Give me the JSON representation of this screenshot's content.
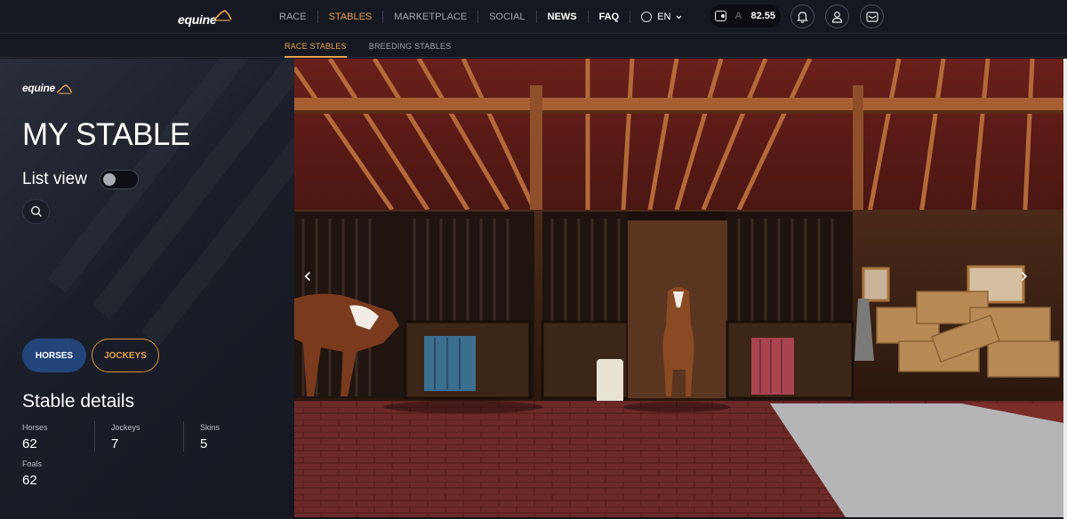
{
  "brand": {
    "logo_text": "equine",
    "accent": "#e6a04d"
  },
  "nav": {
    "items": [
      {
        "label": "RACE"
      },
      {
        "label": "STABLES"
      },
      {
        "label": "MARKETPLACE"
      },
      {
        "label": "SOCIAL"
      },
      {
        "label": "NEWS"
      },
      {
        "label": "FAQ"
      }
    ],
    "language": "EN",
    "language_icon": "globe-icon",
    "wallet_balance": "82.55",
    "wallet_coin": "A",
    "icons": [
      "wallet-icon",
      "bell-icon",
      "user-icon",
      "mail-icon"
    ]
  },
  "subnav": {
    "items": [
      {
        "label": "RACE STABLES"
      },
      {
        "label": "BREEDING STABLES"
      }
    ]
  },
  "sidebar": {
    "title": "MY STABLE",
    "list_view_label": "List view",
    "list_view_enabled": false,
    "search_icon": "search-icon",
    "tabs": [
      {
        "label": "HORSES"
      },
      {
        "label": "JOCKEYS"
      }
    ],
    "details_title": "Stable details",
    "stats": [
      {
        "label": "Horses",
        "value": "62"
      },
      {
        "label": "Jockeys",
        "value": "7"
      },
      {
        "label": "Skins",
        "value": "5"
      },
      {
        "label": "Foals",
        "value": "62"
      }
    ]
  },
  "scene": {
    "prev_arrow": "‹",
    "next_arrow": "›"
  }
}
